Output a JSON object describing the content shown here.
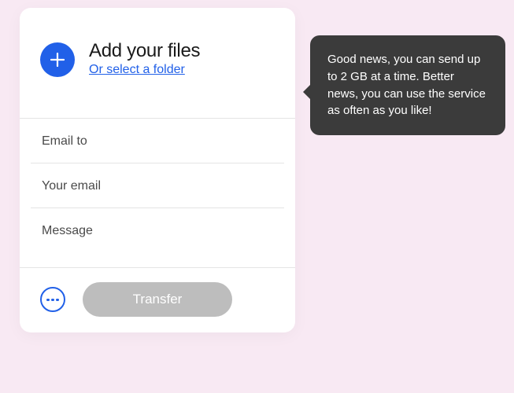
{
  "upload": {
    "heading": "Add your files",
    "folder_link": "Or select a folder"
  },
  "form": {
    "email_to_placeholder": "Email to",
    "your_email_placeholder": "Your email",
    "message_placeholder": "Message"
  },
  "footer": {
    "transfer_label": "Transfer"
  },
  "tooltip": {
    "text": "Good news, you can send up to 2 GB at a time. Better news, you can use the service as often as you like!"
  },
  "colors": {
    "accent": "#2160e8",
    "tooltip_bg": "#3b3b3b",
    "page_bg": "#f8e9f3",
    "disabled": "#bdbdbd"
  }
}
